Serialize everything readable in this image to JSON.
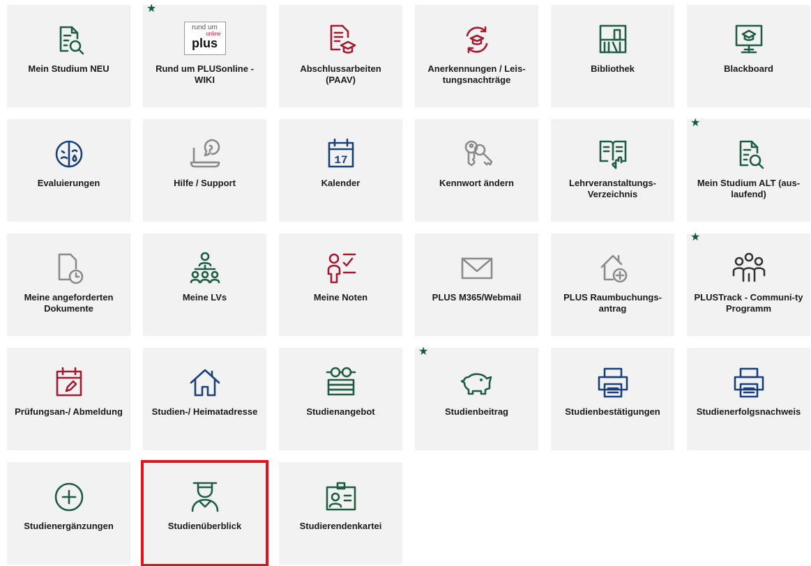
{
  "tiles": [
    {
      "label": "Mein Studium NEU",
      "icon": "document-search-icon",
      "starred": false
    },
    {
      "label": "Rund um PLUSonline - WIKI",
      "icon": "plus-online-logo",
      "starred": true,
      "logo_text_top": "rund um",
      "logo_text_small": "online",
      "logo_text_main": "plus"
    },
    {
      "label": "Abschlussarbeiten (PAAV)",
      "icon": "thesis-graduation-icon",
      "starred": false
    },
    {
      "label": "Anerkennungen / Leis-tungsnachträge",
      "icon": "recognition-cycle-icon",
      "starred": false
    },
    {
      "label": "Bibliothek",
      "icon": "library-icon",
      "starred": false
    },
    {
      "label": "Blackboard",
      "icon": "blackboard-icon",
      "starred": false
    },
    {
      "label": "Evaluierungen",
      "icon": "evaluation-faces-icon",
      "starred": false
    },
    {
      "label": "Hilfe / Support",
      "icon": "help-support-icon",
      "starred": false
    },
    {
      "label": "Kalender",
      "icon": "calendar-icon",
      "starred": false,
      "calendar_day": "17"
    },
    {
      "label": "Kennwort ändern",
      "icon": "keys-icon",
      "starred": false
    },
    {
      "label": "Lehrveranstaltungs-Verzeichnis",
      "icon": "book-touch-icon",
      "starred": false
    },
    {
      "label": "Mein Studium ALT (aus-laufend)",
      "icon": "document-search-icon",
      "starred": true
    },
    {
      "label": "Meine angeforderten Dokumente",
      "icon": "document-clock-icon",
      "starred": false
    },
    {
      "label": "Meine LVs",
      "icon": "hierarchy-people-icon",
      "starred": false
    },
    {
      "label": "Meine Noten",
      "icon": "grades-checklist-icon",
      "starred": false
    },
    {
      "label": "PLUS M365/Webmail",
      "icon": "mail-icon",
      "starred": false
    },
    {
      "label": "PLUS Raumbuchungs-antrag",
      "icon": "room-booking-icon",
      "starred": false
    },
    {
      "label": "PLUSTrack - Communi-ty Programm",
      "icon": "community-icon",
      "starred": true
    },
    {
      "label": "Prüfungsan-/ Abmeldung",
      "icon": "exam-calendar-icon",
      "starred": false
    },
    {
      "label": "Studien-/ Heimatadresse",
      "icon": "home-icon",
      "starred": false
    },
    {
      "label": "Studienangebot",
      "icon": "books-glasses-icon",
      "starred": false
    },
    {
      "label": "Studienbeitrag",
      "icon": "piggy-bank-icon",
      "starred": true
    },
    {
      "label": "Studienbestätigungen",
      "icon": "printer-icon",
      "starred": false
    },
    {
      "label": "Studienerfolgsnachweis",
      "icon": "printer-icon",
      "starred": false
    },
    {
      "label": "Studienergänzungen",
      "icon": "plus-circle-icon",
      "starred": false
    },
    {
      "label": "Studienüberblick",
      "icon": "graduate-person-icon",
      "starred": false,
      "selected": true
    },
    {
      "label": "Studierendenkartei",
      "icon": "id-card-icon",
      "starred": false
    }
  ],
  "colors": {
    "green": "#1d5e43",
    "red": "#a31a2e",
    "blue": "#173f7a",
    "highlight": "#e8101a",
    "tile_bg": "#f2f2f2"
  }
}
